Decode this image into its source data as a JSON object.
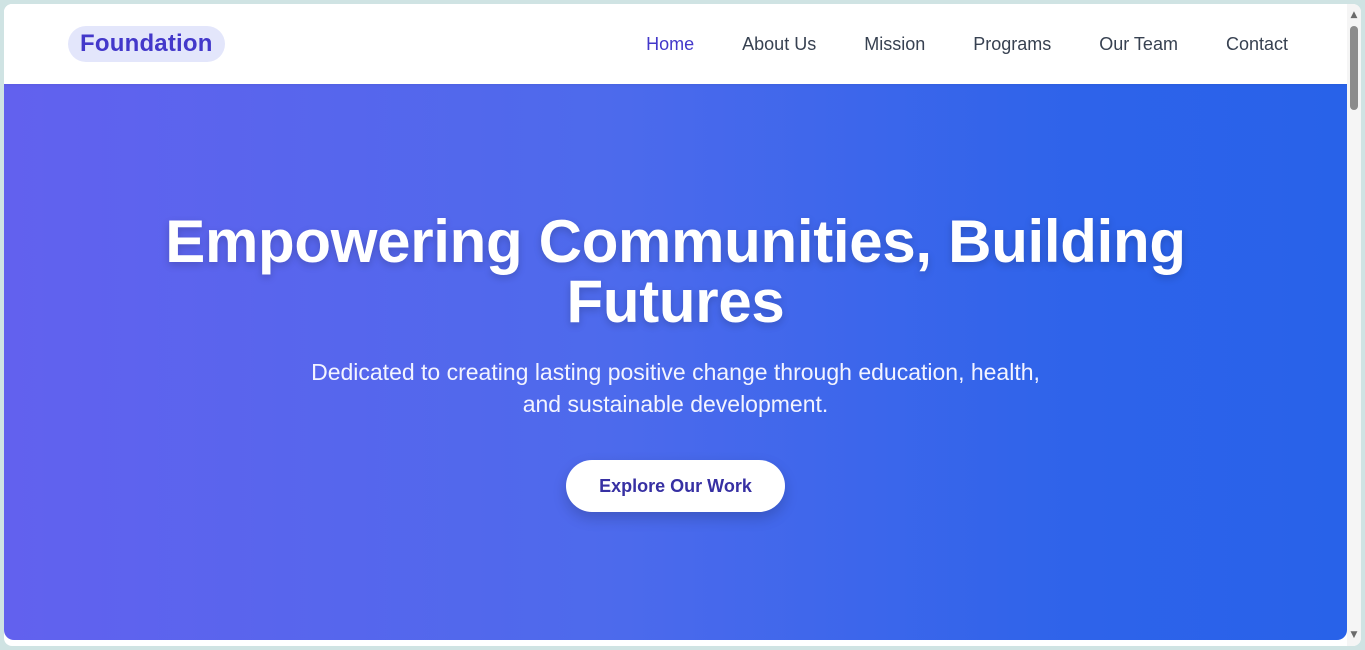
{
  "header": {
    "logo_text": "Foundation",
    "nav": [
      {
        "label": "Home",
        "active": true
      },
      {
        "label": "About Us",
        "active": false
      },
      {
        "label": "Mission",
        "active": false
      },
      {
        "label": "Programs",
        "active": false
      },
      {
        "label": "Our Team",
        "active": false
      },
      {
        "label": "Contact",
        "active": false
      }
    ]
  },
  "hero": {
    "title": "Empowering Communities, Building Futures",
    "subtitle": "Dedicated to creating lasting positive change through education, health, and sustainable development.",
    "cta_label": "Explore Our Work"
  },
  "scrollbar": {
    "up_icon": "▲",
    "down_icon": "▼"
  },
  "colors": {
    "brand": "#4338ca",
    "hero_gradient_start": "#6261ee",
    "hero_gradient_end": "#2862e9"
  }
}
